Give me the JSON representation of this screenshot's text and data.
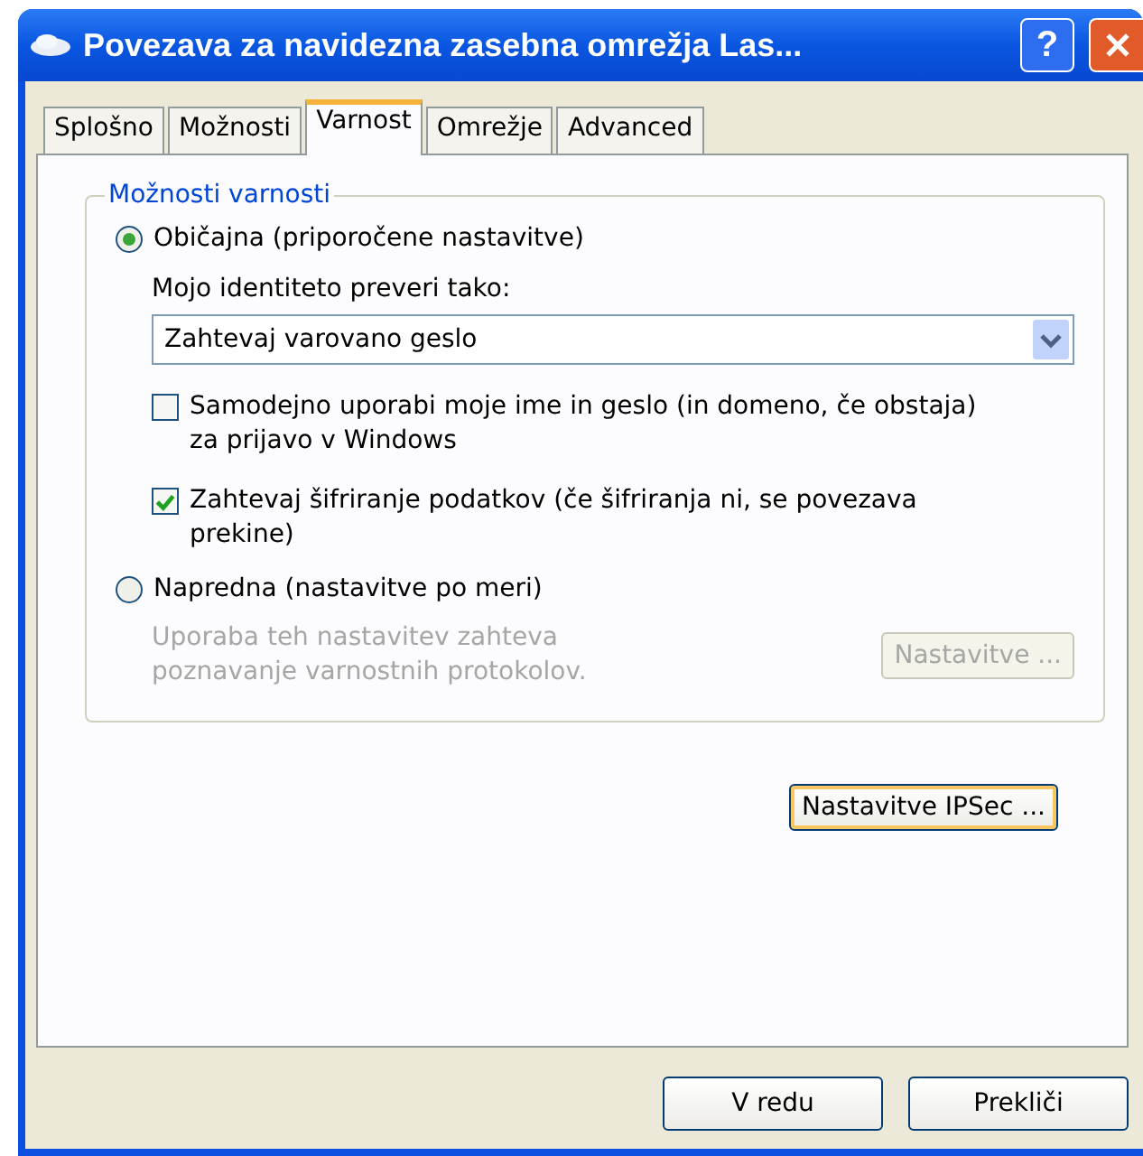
{
  "window": {
    "title": "Povezava za navidezna zasebna omrežja Las...",
    "help_button": "?"
  },
  "tabs": [
    {
      "label": "Splošno",
      "selected": false
    },
    {
      "label": "Možnosti",
      "selected": false
    },
    {
      "label": "Varnost",
      "selected": true
    },
    {
      "label": "Omrežje",
      "selected": false
    },
    {
      "label": "Advanced",
      "selected": false
    }
  ],
  "security_group": {
    "title": "Možnosti varnosti",
    "typical": {
      "label": "Običajna (priporočene nastavitve)",
      "selected": true,
      "identity_label": "Mojo identiteto preveri tako:",
      "identity_dropdown": {
        "value": "Zahtevaj varovano geslo"
      },
      "checkboxes": [
        {
          "label": "Samodejno uporabi moje ime in geslo (in domeno, če obstaja) za prijavo v Windows",
          "checked": false
        },
        {
          "label": "Zahtevaj šifriranje podatkov (če šifriranja ni, se povezava prekine)",
          "checked": true
        }
      ]
    },
    "advanced": {
      "label": "Napredna (nastavitve po meri)",
      "selected": false,
      "note": "Uporaba teh nastavitev zahteva poznavanje varnostnih protokolov.",
      "disabled": true,
      "button": {
        "label": "Nastavitve ..."
      }
    }
  },
  "ipsec_button": {
    "label": "Nastavitve IPSec ...",
    "focused": true
  },
  "buttons": [
    "V redu",
    "Prekliči"
  ]
}
